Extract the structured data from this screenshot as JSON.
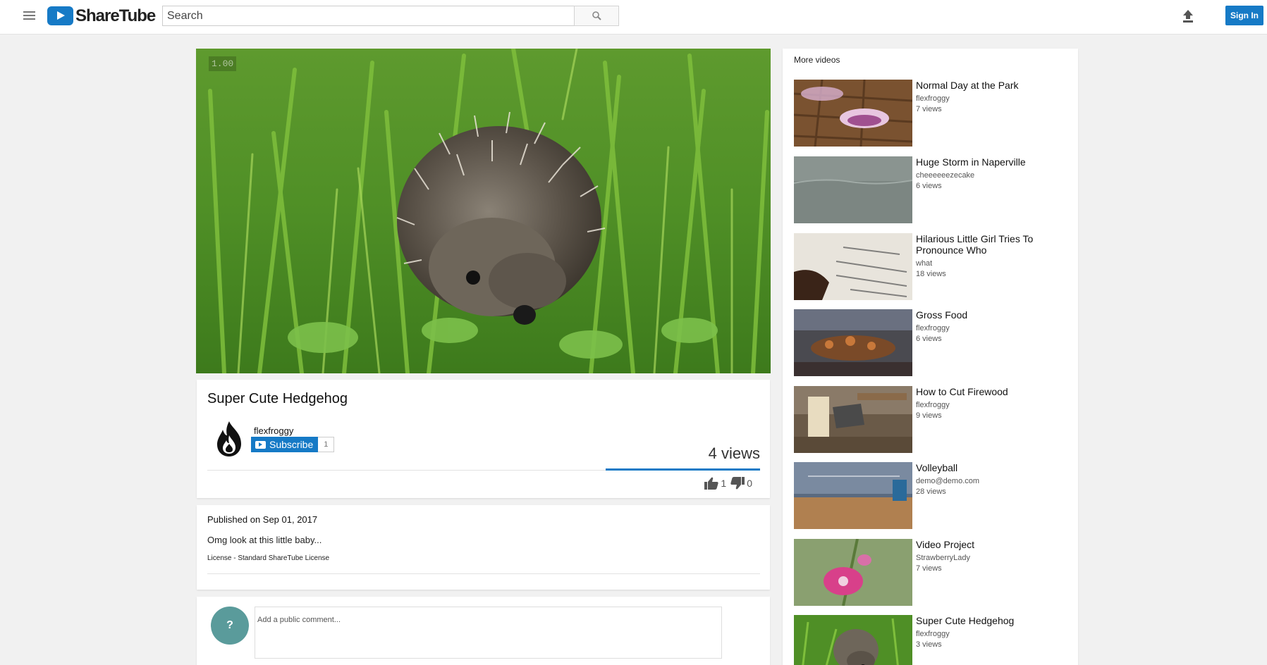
{
  "app": {
    "name": "ShareTube"
  },
  "header": {
    "search_placeholder": "Search",
    "signin_label": "Sign In"
  },
  "player": {
    "speed_label": "1.00"
  },
  "video": {
    "title": "Super Cute Hedgehog",
    "owner": "flexfroggy",
    "subscribe_label": "Subscribe",
    "subscriber_count": "1",
    "views": "4 views",
    "likes": "1",
    "dislikes": "0",
    "published": "Published on Sep 01, 2017",
    "description": "Omg look at this little baby...",
    "license": "License - Standard ShareTube License"
  },
  "comments": {
    "avatar_letter": "?",
    "placeholder": "Add a public comment..."
  },
  "sidebar": {
    "heading": "More videos",
    "items": [
      {
        "title": "Normal Day at the Park",
        "owner": "flexfroggy",
        "views": "7 views",
        "thumb": "thumb-onion"
      },
      {
        "title": "Huge Storm in Naperville",
        "owner": "cheeeeeezecake",
        "views": "6 views",
        "thumb": "thumb-storm"
      },
      {
        "title": "Hilarious Little Girl Tries To Pronounce Who",
        "owner": "what",
        "views": "18 views",
        "thumb": "thumb-book"
      },
      {
        "title": "Gross Food",
        "owner": "flexfroggy",
        "views": "6 views",
        "thumb": "thumb-food"
      },
      {
        "title": "How to Cut Firewood",
        "owner": "flexfroggy",
        "views": "9 views",
        "thumb": "thumb-axe"
      },
      {
        "title": "Volleyball",
        "owner": "demo@demo.com",
        "views": "28 views",
        "thumb": "thumb-gym"
      },
      {
        "title": "Video Project",
        "owner": "StrawberryLady",
        "views": "7 views",
        "thumb": "thumb-flower"
      },
      {
        "title": "Super Cute Hedgehog",
        "owner": "flexfroggy",
        "views": "3 views",
        "thumb": "thumb-hedgehog"
      }
    ]
  },
  "colors": {
    "brand": "#167ac6",
    "background": "#f1f1f1",
    "comment_avatar": "#5a9b9b"
  },
  "icons": [
    "menu-icon",
    "logo-play-icon",
    "search-icon",
    "upload-icon",
    "thumbs-up-icon",
    "thumbs-down-icon",
    "fire-icon"
  ]
}
